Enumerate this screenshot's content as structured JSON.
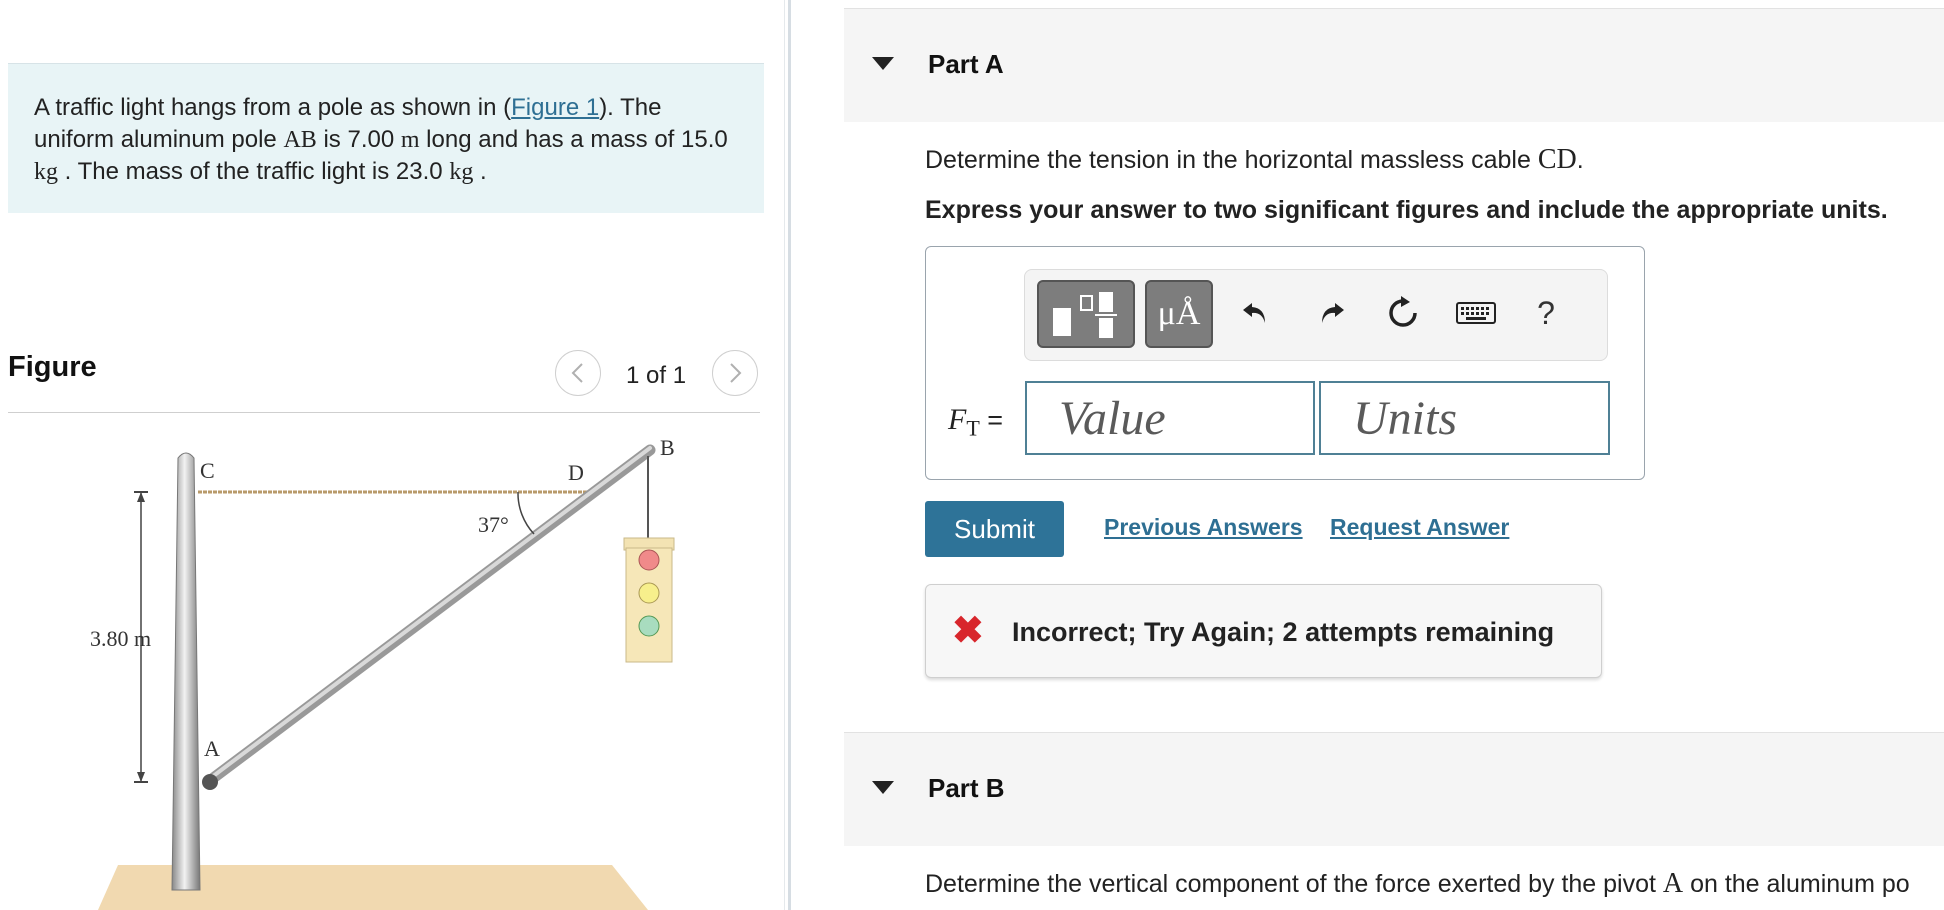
{
  "problem": {
    "text_1": "A traffic light hangs from a pole as shown in (",
    "figure_link": "Figure 1",
    "text_2": "). The uniform aluminum pole ",
    "pole_name": "AB",
    "text_3": " is 7.00 ",
    "unit_m": "m",
    "text_4": " long and has a mass of 15.0 ",
    "unit_kg": "kg",
    "text_5": " . The mass of the traffic light is 23.0 ",
    "unit_kg2": "kg",
    "text_6": " ."
  },
  "figure": {
    "heading": "Figure",
    "counter": "1 of 1",
    "prev_icon": "chevron-left-icon",
    "next_icon": "chevron-right-icon",
    "labels": {
      "C": "C",
      "D": "D",
      "B": "B",
      "A": "A",
      "angle": "37°",
      "height": "3.80 m"
    }
  },
  "part_a": {
    "title": "Part A",
    "question_prefix": "Determine the tension in the horizontal massless cable ",
    "question_symbol": "CD",
    "question_suffix": ".",
    "instruction": "Express your answer to two significant figures and include the appropriate units.",
    "toolbar": {
      "units_button": "μÅ",
      "help": "?",
      "icons": [
        "templates-icon",
        "units-icon",
        "undo-icon",
        "redo-icon",
        "reset-icon",
        "keyboard-icon",
        "help-icon"
      ]
    },
    "label_symbol": "F",
    "label_subscript": "T",
    "label_equals": " =",
    "value_placeholder": "Value",
    "units_placeholder": "Units",
    "submit": "Submit",
    "previous_answers": "Previous Answers",
    "request_answer": "Request Answer",
    "feedback": "Incorrect; Try Again; 2 attempts remaining"
  },
  "part_b": {
    "title": "Part B",
    "question_prefix": "Determine the vertical component of the force exerted by the pivot ",
    "question_symbol": "A",
    "question_suffix": " on the aluminum po"
  },
  "colors": {
    "accent": "#2e7398",
    "link": "#2e6f93",
    "problem_bg": "#e8f4f6",
    "error": "#d8262c"
  }
}
